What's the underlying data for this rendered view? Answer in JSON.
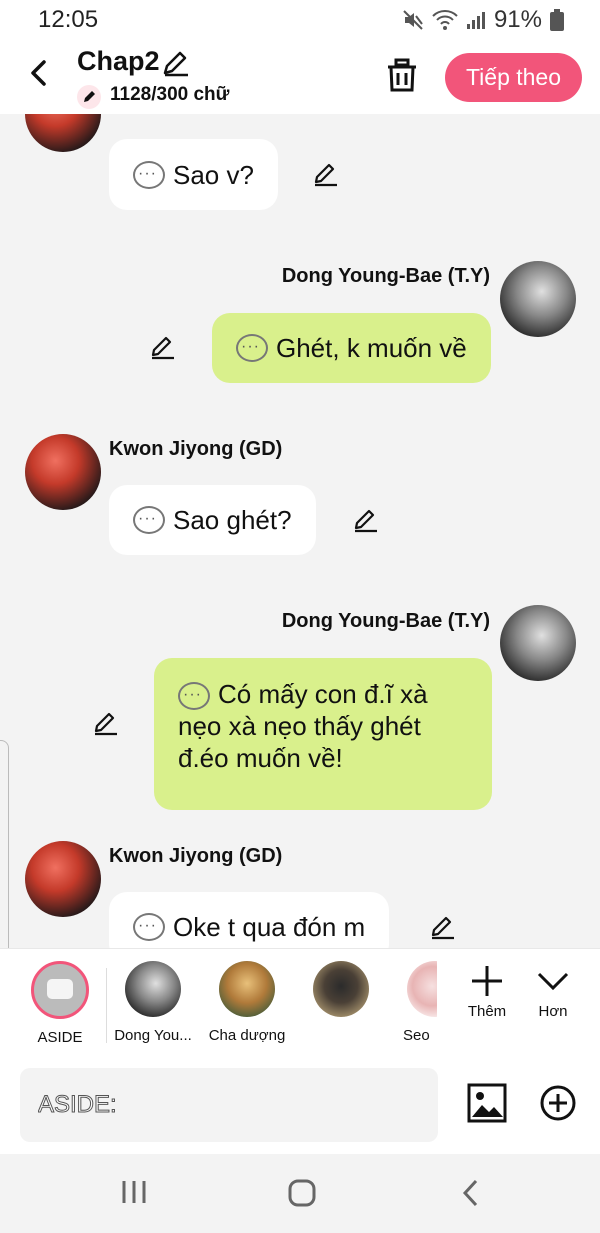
{
  "status": {
    "time": "12:05",
    "battery": "91%"
  },
  "header": {
    "title": "Chap2",
    "word_count": "1128/300 chữ",
    "next_label": "Tiếp theo"
  },
  "messages": [
    {
      "speaker": "",
      "text": "Sao v?"
    },
    {
      "speaker": "Dong Young-Bae (T.Y)",
      "text": "Ghét, k muốn về"
    },
    {
      "speaker": "Kwon Jiyong (GD)",
      "text": "Sao ghét?"
    },
    {
      "speaker": "Dong Young-Bae (T.Y)",
      "lines": [
        "Có mấy con đ.ĩ xà",
        "nẹo xà nẹo thấy ghét",
        "đ.éo muốn về!"
      ]
    },
    {
      "speaker": "Kwon Jiyong (GD)",
      "text": "Oke t qua đón m"
    }
  ],
  "characters": [
    {
      "label": "ASIDE"
    },
    {
      "label": "Dong You..."
    },
    {
      "label": "Cha dượng"
    },
    {
      "label": ""
    },
    {
      "label": "Seo"
    }
  ],
  "actions": {
    "add_label": "Thêm",
    "more_label": "Hơn"
  },
  "input": {
    "placeholder": "ASIDE:"
  },
  "colors": {
    "accent": "#f2557a",
    "bubble_green": "#d9f08c",
    "bubble_white": "#ffffff"
  }
}
